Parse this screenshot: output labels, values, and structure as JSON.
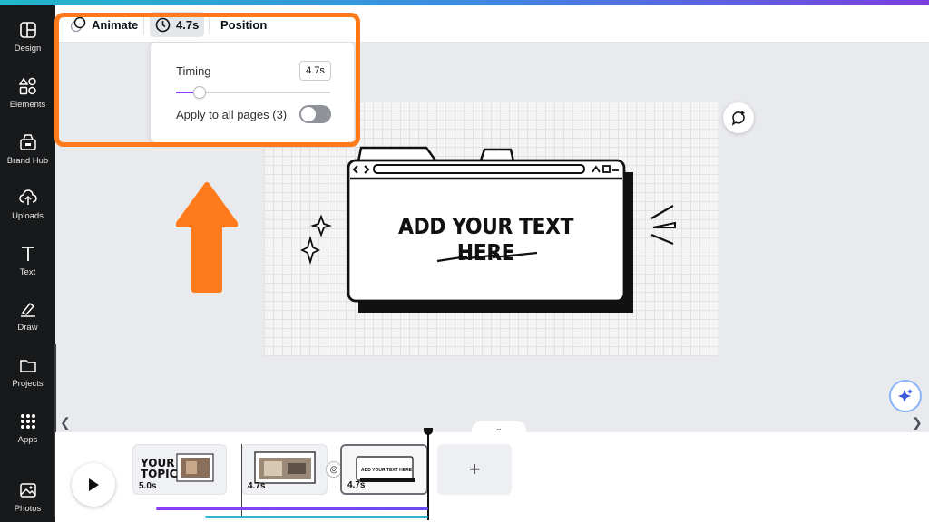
{
  "sidebar": {
    "items": [
      {
        "label": "Design",
        "icon": "design-icon"
      },
      {
        "label": "Elements",
        "icon": "elements-icon"
      },
      {
        "label": "Brand Hub",
        "icon": "brand-hub-icon"
      },
      {
        "label": "Uploads",
        "icon": "uploads-icon"
      },
      {
        "label": "Text",
        "icon": "text-icon"
      },
      {
        "label": "Draw",
        "icon": "draw-icon"
      },
      {
        "label": "Projects",
        "icon": "projects-icon"
      },
      {
        "label": "Apps",
        "icon": "apps-icon"
      },
      {
        "label": "Photos",
        "icon": "photos-icon"
      }
    ]
  },
  "toolbar": {
    "animate_label": "Animate",
    "duration_label": "4.7s",
    "position_label": "Position"
  },
  "timing_popover": {
    "timing_label": "Timing",
    "timing_value": "4.7s",
    "slider_fraction": 0.15,
    "apply_label": "Apply to all pages (3)",
    "apply_toggle_on": false
  },
  "canvas": {
    "headline": "ADD YOUR TEXT HERE"
  },
  "timeline": {
    "clips": [
      {
        "duration": "5.0s",
        "thumb_text_line1": "YOUR",
        "thumb_text_line2": "TOPIC"
      },
      {
        "duration": "4.7s"
      },
      {
        "duration": "4.7s",
        "thumb_text": "ADD YOUR TEXT HERE"
      }
    ],
    "add_label": "+"
  },
  "colors": {
    "accent_purple": "#8b3dff",
    "highlight_orange": "#ff7a1a",
    "sidebar_bg": "#18191b"
  }
}
